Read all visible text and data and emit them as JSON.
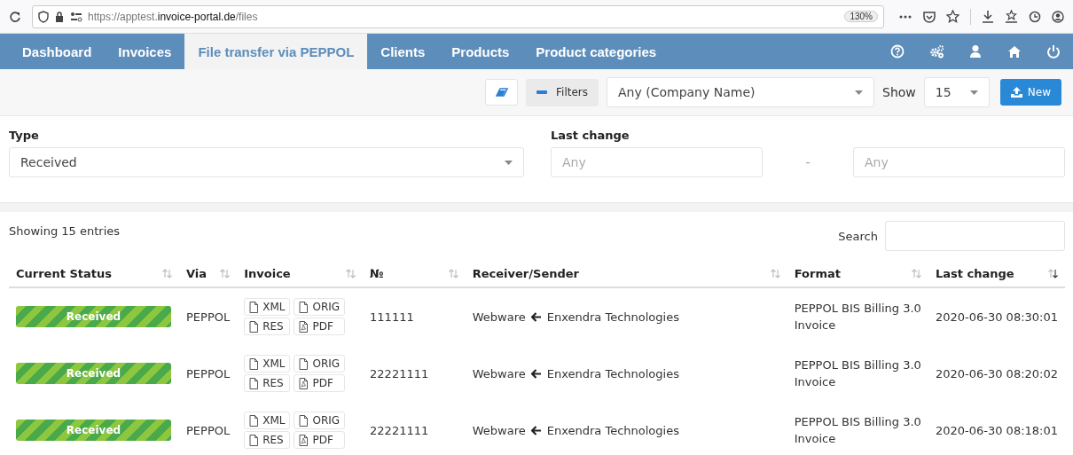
{
  "browser": {
    "url": "https://apptest.**invoice-portal.de**/files",
    "zoom": "130%"
  },
  "nav": {
    "items": [
      {
        "label": "Dashboard",
        "selected": false
      },
      {
        "label": "Invoices",
        "selected": false
      },
      {
        "label": "File transfer via PEPPOL",
        "selected": true
      },
      {
        "label": "Clients",
        "selected": false
      },
      {
        "label": "Products",
        "selected": false
      },
      {
        "label": "Product categories",
        "selected": false
      }
    ]
  },
  "toolbar": {
    "filters_button": "Filters",
    "company_select": "Any (Company Name)",
    "show_label": "Show",
    "show_select": "15",
    "new_button": "New"
  },
  "filters": {
    "type_label": "Type",
    "type_value": "Received",
    "last_change_label": "Last change",
    "from_placeholder": "Any",
    "separator": "-",
    "to_placeholder": "Any"
  },
  "table": {
    "info": "Showing 15 entries",
    "search_label": "Search",
    "columns": [
      {
        "label": "Current Status",
        "sorted": false
      },
      {
        "label": "Via",
        "sorted": false
      },
      {
        "label": "Invoice",
        "sorted": false
      },
      {
        "label": "№",
        "sorted": false
      },
      {
        "label": "Receiver/Sender",
        "sorted": false
      },
      {
        "label": "Format",
        "sorted": false
      },
      {
        "label": "Last change",
        "sorted": true
      }
    ],
    "rows": [
      {
        "status": "Received",
        "via": "PEPPOL",
        "files": [
          "XML",
          "ORIG",
          "RES",
          "PDF"
        ],
        "number": "111111",
        "receiver": "Webware",
        "sender": "Enxendra Technologies",
        "format": "PEPPOL BIS Billing 3.0 Invoice",
        "last_change": "2020-06-30 08:30:01"
      },
      {
        "status": "Received",
        "via": "PEPPOL",
        "files": [
          "XML",
          "ORIG",
          "RES",
          "PDF"
        ],
        "number": "22221111",
        "receiver": "Webware",
        "sender": "Enxendra Technologies",
        "format": "PEPPOL BIS Billing 3.0 Invoice",
        "last_change": "2020-06-30 08:20:02"
      },
      {
        "status": "Received",
        "via": "PEPPOL",
        "files": [
          "XML",
          "ORIG",
          "RES",
          "PDF"
        ],
        "number": "22221111",
        "receiver": "Webware",
        "sender": "Enxendra Technologies",
        "format": "PEPPOL BIS Billing 3.0 Invoice",
        "last_change": "2020-06-30 08:18:01"
      }
    ]
  }
}
